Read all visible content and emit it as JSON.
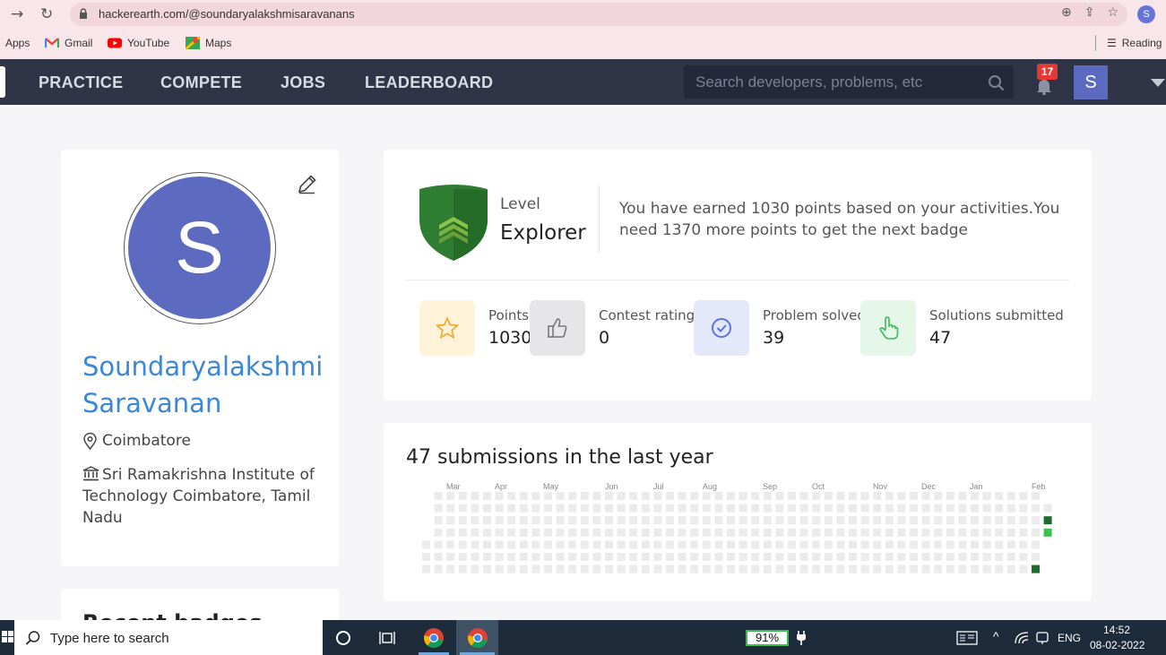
{
  "browser": {
    "url": "hackerearth.com/@soundaryalakshmisaravanans",
    "profile_initial": "S",
    "bookmarks": [
      {
        "label": "Apps"
      },
      {
        "label": "Gmail"
      },
      {
        "label": "YouTube"
      },
      {
        "label": "Maps"
      }
    ],
    "reading_list": "Reading"
  },
  "nav": {
    "items": [
      "PRACTICE",
      "COMPETE",
      "JOBS",
      "LEADERBOARD"
    ],
    "search_placeholder": "Search developers, problems, etc",
    "notification_count": "17",
    "avatar_initial": "S"
  },
  "profile": {
    "initial": "S",
    "name": "Soundaryalakshmi Saravanan",
    "location": "Coimbatore",
    "institution": "Sri Ramakrishna Institute of Technology Coimbatore, Tamil Nadu",
    "recent_badges_heading": "Recent badges"
  },
  "level": {
    "label": "Level",
    "value": "Explorer",
    "message": "You have earned 1030 points based on your activities.You need 1370 more points to get the next badge",
    "colors": {
      "shield": "#2e7d32",
      "shield_inner": "#7cb342"
    }
  },
  "stats": [
    {
      "label": "Points",
      "value": "1030",
      "icon": "star-icon",
      "tile_color": "#fff4d9"
    },
    {
      "label": "Contest ratings",
      "value": "0",
      "icon": "thumbs-up-icon",
      "tile_color": "#e6e6e8"
    },
    {
      "label": "Problem solved",
      "value": "39",
      "icon": "check-circle-icon",
      "tile_color": "#e3e8fb"
    },
    {
      "label": "Solutions submitted",
      "value": "47",
      "icon": "hand-pointer-icon",
      "tile_color": "#e4f7e8"
    }
  ],
  "submissions": {
    "title": "47 submissions in the last year",
    "months": [
      "Mar",
      "Apr",
      "May",
      "Jun",
      "Jul",
      "Aug",
      "Sep",
      "Oct",
      "Nov",
      "Dec",
      "Jan",
      "Feb"
    ],
    "colors": {
      "empty": "#ebebeb",
      "dark": "#1e6b2c",
      "mid": "#39c24d",
      "light": "#7ddc88"
    }
  },
  "taskbar": {
    "search_placeholder": "Type here to search",
    "battery": "91%",
    "language": "ENG",
    "time": "14:52",
    "date": "08-02-2022"
  }
}
